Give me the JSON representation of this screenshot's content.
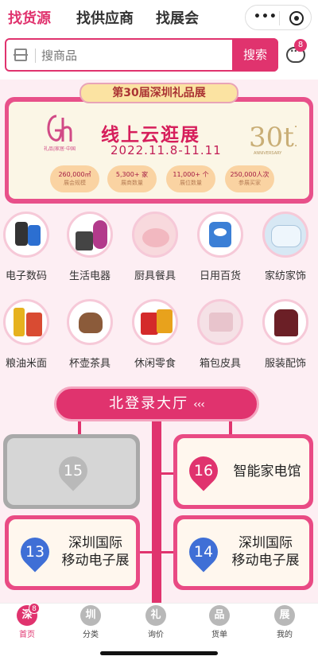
{
  "top_tabs": [
    "找货源",
    "找供应商",
    "找展会"
  ],
  "search": {
    "placeholder": "搜商品",
    "button": "搜索"
  },
  "chat_badge": "8",
  "banner": {
    "top_label": "第30届深圳礼品展",
    "title": "线上云逛展",
    "date": "2022.11.8-11.11",
    "logo_caption": "礼品|家居·中国",
    "anniversary": "30th",
    "anniversary_caption": "ANNIVERSARY",
    "stats": [
      {
        "value": "260,000㎡",
        "label": "展会规模"
      },
      {
        "value": "5,300+ 家",
        "label": "展商数量"
      },
      {
        "value": "11,000+ 个",
        "label": "展位数量"
      },
      {
        "value": "250,000人次",
        "label": "参展买家"
      }
    ]
  },
  "categories": [
    "电子数码",
    "生活电器",
    "厨具餐具",
    "日用百货",
    "家纺家饰",
    "粮油米面",
    "杯壶茶具",
    "休闲零食",
    "箱包皮具",
    "服装配饰"
  ],
  "hall": {
    "title": "北登录大厅",
    "arrows": "‹‹‹",
    "booths": [
      {
        "number": "15",
        "name": ""
      },
      {
        "number": "16",
        "name": "智能家电馆"
      },
      {
        "number": "13",
        "name_line1": "深圳国际",
        "name_line2": "移动电子展"
      },
      {
        "number": "14",
        "name_line1": "深圳国际",
        "name_line2": "移动电子展"
      }
    ]
  },
  "tabbar": {
    "items": [
      {
        "icon_char": "深",
        "label": "首页",
        "badge": "8"
      },
      {
        "icon_char": "圳",
        "label": "分类"
      },
      {
        "icon_char": "礼",
        "label": "询价"
      },
      {
        "icon_char": "品",
        "label": "货单"
      },
      {
        "icon_char": "展",
        "label": "我的"
      }
    ]
  },
  "colors": {
    "accent": "#e0336e",
    "background": "#fdeef3"
  }
}
